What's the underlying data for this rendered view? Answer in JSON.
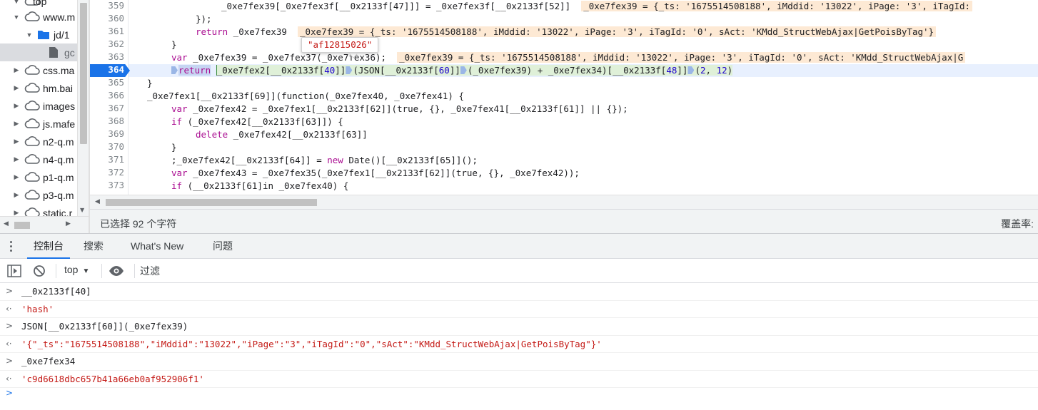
{
  "tree": {
    "items": [
      {
        "label": "top",
        "type": "cloud",
        "expanded": true
      },
      {
        "label": "www.m",
        "type": "cloud",
        "expanded": true
      },
      {
        "label": "jd/1",
        "type": "folder",
        "expanded": true
      },
      {
        "label": "gc",
        "type": "file",
        "selected": true
      },
      {
        "label": "css.ma",
        "type": "cloud",
        "expanded": false
      },
      {
        "label": "hm.bai",
        "type": "cloud",
        "expanded": false
      },
      {
        "label": "images",
        "type": "cloud",
        "expanded": false
      },
      {
        "label": "js.mafe",
        "type": "cloud",
        "expanded": false
      },
      {
        "label": "n2-q.m",
        "type": "cloud",
        "expanded": false
      },
      {
        "label": "n4-q.m",
        "type": "cloud",
        "expanded": false
      },
      {
        "label": "p1-q.m",
        "type": "cloud",
        "expanded": false
      },
      {
        "label": "p3-q.m",
        "type": "cloud",
        "expanded": false
      },
      {
        "label": "static.r",
        "type": "cloud",
        "expanded": false
      }
    ]
  },
  "editor": {
    "line_numbers": [
      "359",
      "360",
      "361",
      "362",
      "363",
      "364",
      "365",
      "366",
      "367",
      "368",
      "369",
      "370",
      "371",
      "372",
      "373"
    ],
    "active_line": "364",
    "tooltip": "\"af12815026\"",
    "lines": {
      "l359": "_0xe7fex39[_0xe7fex3f[__0x2133f[47]]] = _0xe7fex3f[__0x2133f[52]]",
      "l359_val": "_0xe7fex39 = {_ts: '1675514508188', iMddid: '13022', iPage: '3', iTagId:",
      "l360": "});",
      "l361_kw": "return",
      "l361_rest": " _0xe7fex39",
      "l361_val": "_0xe7fex39 = {_ts: '1675514508188', iMddid: '13022', iPage: '3', iTagId: '0', sAct: 'KMdd_StructWebAjax|GetPoisByTag'}",
      "l362": "}",
      "l363_kw": "var",
      "l363_rest": " _0xe7fex39 = _0xe7fex37(_0xe7fex36);",
      "l363_val": "_0xe7fex39 = {_ts: '1675514508188', iMddid: '13022', iPage: '3', iTagId: '0', sAct: 'KMdd_StructWebAjax|G",
      "l364_kw": "return",
      "l364_p1": "_0xe7fex2[__0x2133f[",
      "l364_n1": "40",
      "l364_p2": "]]",
      "l364_p3": "(JSON[__0x2133f[",
      "l364_n2": "60",
      "l364_p4": "]]",
      "l364_p5": "(_0xe7fex39) + _0xe7fex34)[__0x2133f[",
      "l364_n3": "48",
      "l364_p6": "]]",
      "l364_p7": "(",
      "l364_n4": "2",
      "l364_p8": ", ",
      "l364_n5": "12",
      "l364_p9": ")",
      "l365": "}",
      "l366": "_0xe7fex1[__0x2133f[69]](function(_0xe7fex40, _0xe7fex41) {",
      "l367_kw": "var",
      "l367_rest": " _0xe7fex42 = _0xe7fex1[__0x2133f[62]](true, {}, _0xe7fex41[__0x2133f[61]] || {});",
      "l368_kw": "if",
      "l368_rest": " (_0xe7fex42[__0x2133f[63]]) {",
      "l369_kw": "delete",
      "l369_rest": " _0xe7fex42[__0x2133f[63]]",
      "l370": "}",
      "l371_a": ";_0xe7fex42[__0x2133f[64]] = ",
      "l371_kw": "new",
      "l371_b": " Date()[__0x2133f[65]]();",
      "l372_kw": "var",
      "l372_rest": " _0xe7fex43 = _0xe7fex35(_0xe7fex1[__0x2133f[62]](true, {}, _0xe7fex42));",
      "l373_kw": "if",
      "l373_rest": " (__0x2133f[61]in _0xe7fex40) {"
    }
  },
  "status": {
    "selection": "已选择 92 个字符",
    "coverage": "覆盖率:"
  },
  "drawer": {
    "tabs": [
      "控制台",
      "搜索",
      "What's New",
      "问题"
    ],
    "active_tab": "控制台"
  },
  "console_toolbar": {
    "context": "top",
    "filter_placeholder": "过滤"
  },
  "console": {
    "entries": [
      {
        "kind": "input",
        "text": "__0x2133f[40]"
      },
      {
        "kind": "result",
        "text": "'hash'"
      },
      {
        "kind": "input",
        "text": "JSON[__0x2133f[60]](_0xe7fex39)"
      },
      {
        "kind": "result",
        "text": "'{\"_ts\":\"1675514508188\",\"iMddid\":\"13022\",\"iPage\":\"3\",\"iTagId\":\"0\",\"sAct\":\"KMdd_StructWebAjax|GetPoisByTag\"}'"
      },
      {
        "kind": "input",
        "text": "_0xe7fex34"
      },
      {
        "kind": "result",
        "text": "'c9d6618dbc657b41a66eb0af952906f1'"
      }
    ]
  },
  "colors": {
    "accent": "#1a73e8",
    "keyword": "#aa0d91",
    "number": "#1c00cf",
    "string": "#c41a16",
    "inline_value_bg": "#fde9d4"
  }
}
